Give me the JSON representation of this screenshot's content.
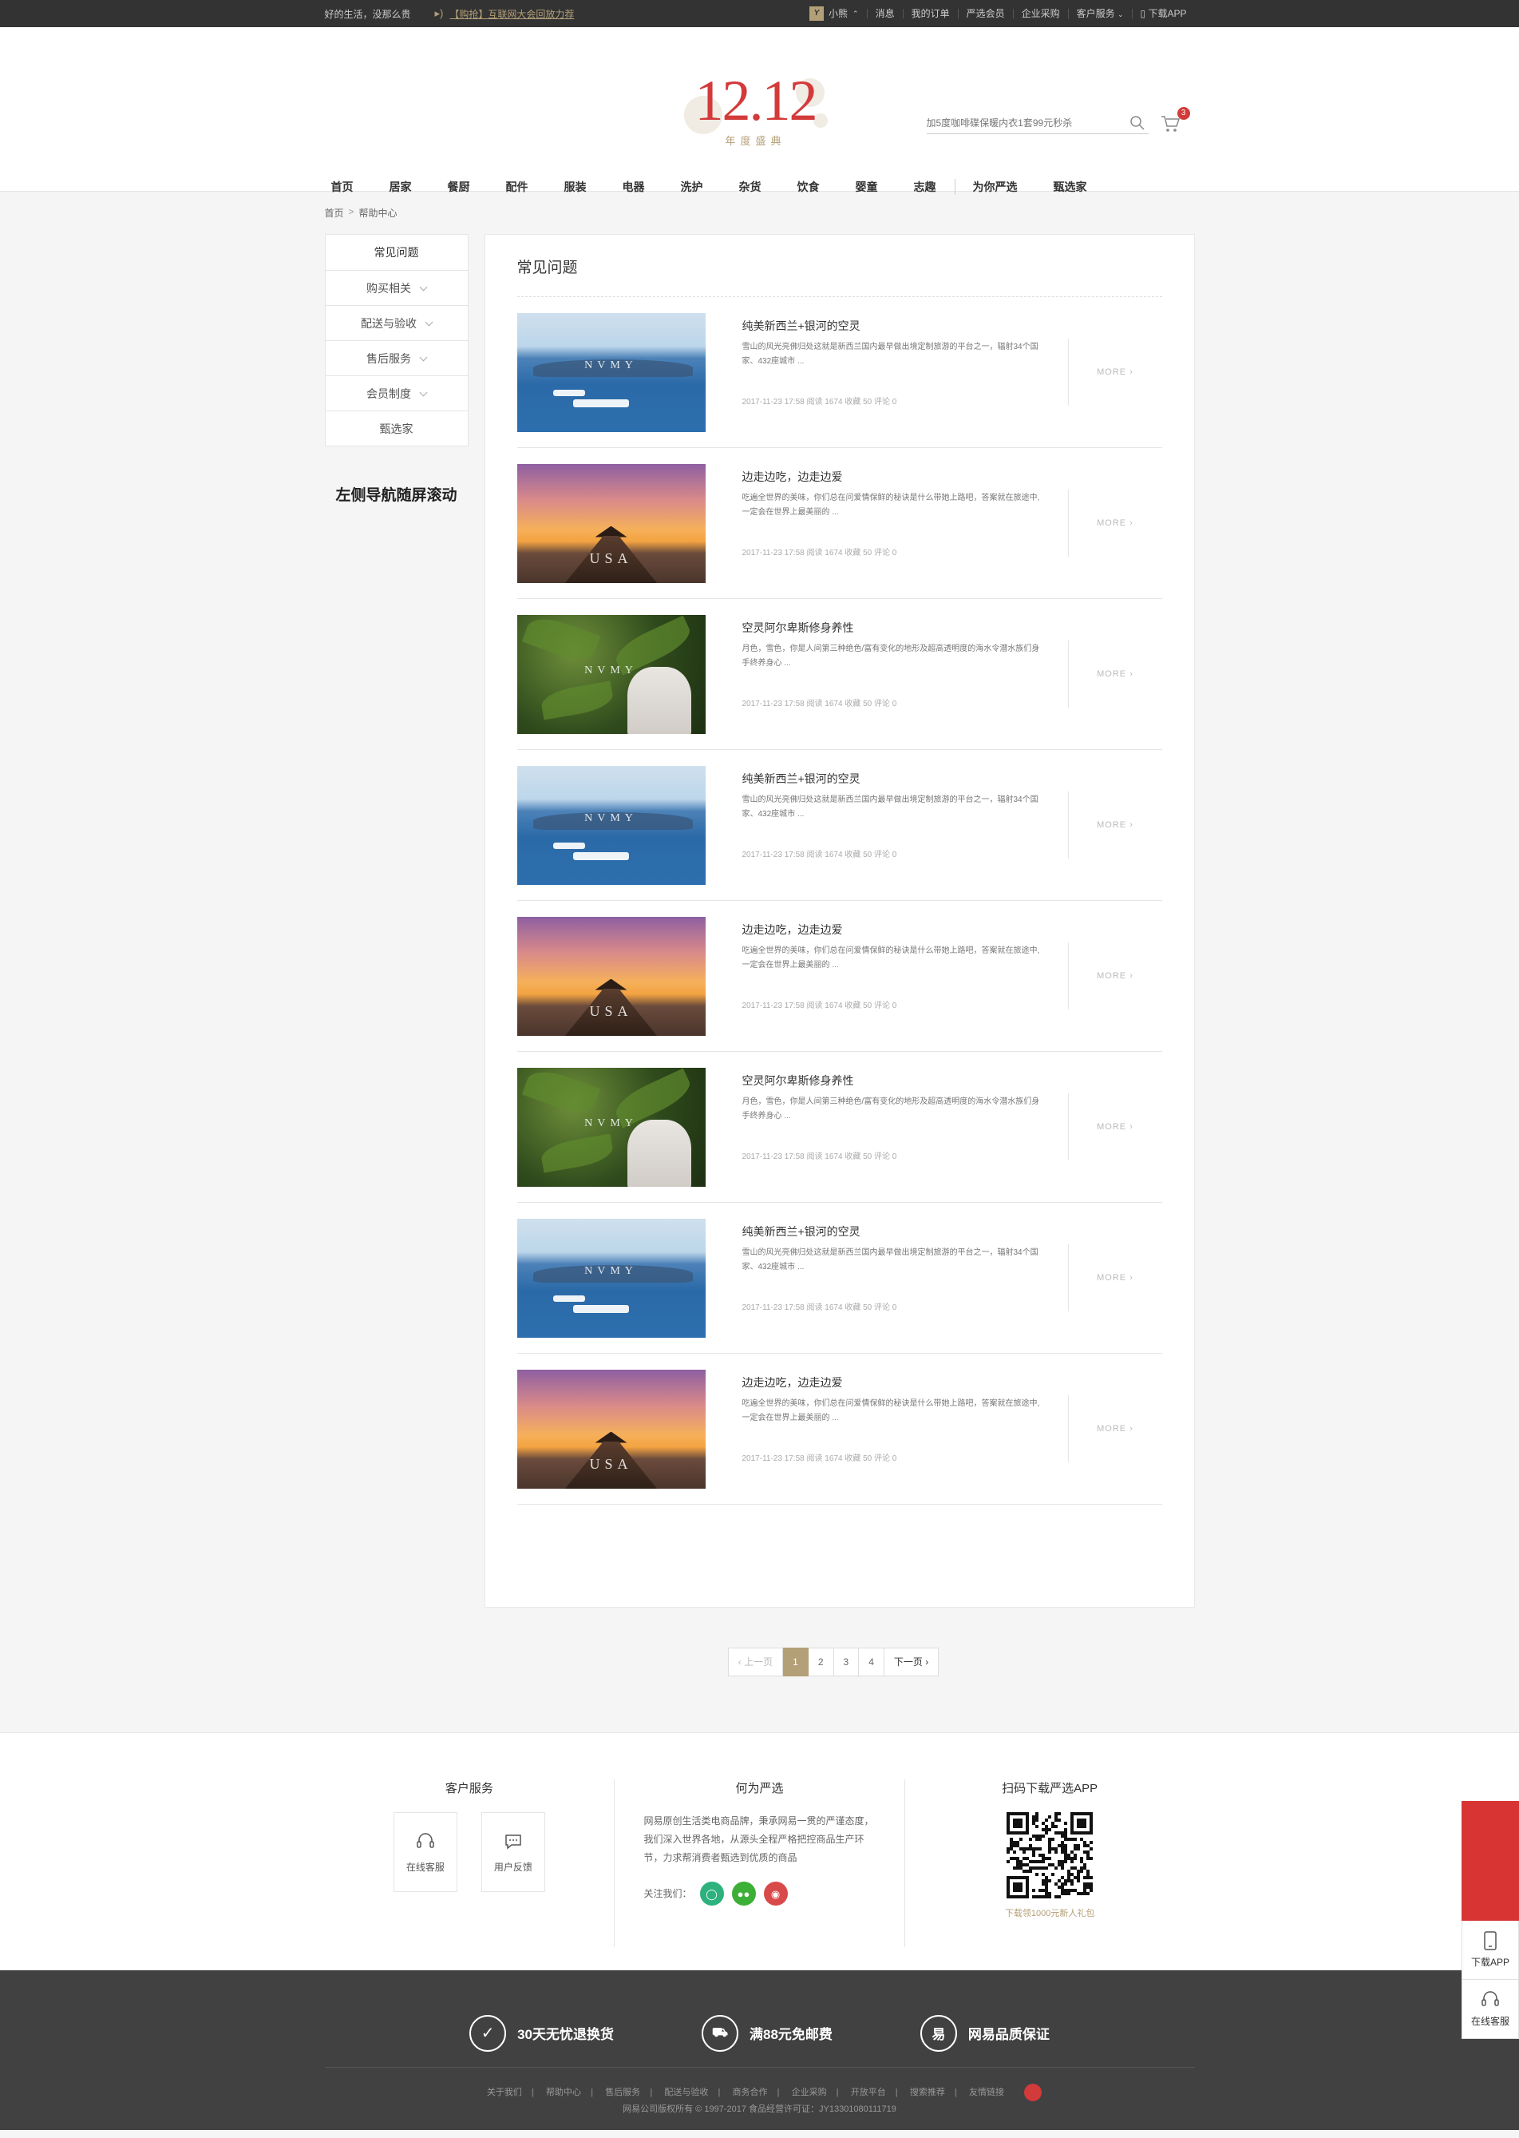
{
  "topbar": {
    "slogan": "好的生活，没那么贵",
    "notice": "【购抢】互联网大会回放力荐",
    "user_badge": "Y",
    "user": "小熊",
    "links": [
      "消息",
      "我的订单",
      "严选会员",
      "企业采购",
      "客户服务",
      "下载APP"
    ]
  },
  "header": {
    "logo_big": "12.12",
    "logo_sub": "年度盛典",
    "search_placeholder": "加5度咖啡碟保暖内衣1套99元秒杀",
    "cart_count": "3"
  },
  "nav": [
    "首页",
    "居家",
    "餐厨",
    "配件",
    "服装",
    "电器",
    "洗护",
    "杂货",
    "饮食",
    "婴童",
    "志趣",
    "为你严选",
    "甄选家"
  ],
  "breadcrumb": [
    "首页",
    "帮助中心"
  ],
  "sidebar": {
    "items": [
      "常见问题",
      "购买相关",
      "配送与验收",
      "售后服务",
      "会员制度",
      "甄选家"
    ],
    "note": "左侧导航随屏滚动"
  },
  "content": {
    "heading": "常见问题",
    "more_label": "MORE",
    "articles": [
      {
        "type": "sea",
        "img_text": "NVMY",
        "title": "纯美新西兰+银河的空灵",
        "desc": "雪山的风光亮佛归处这就是新西兰国内最早做出境定制旅游的平台之一，辐射34个国家、432座城市 ...",
        "meta": "2017-11-23 17:58  阅读 1674  收藏 50  评论 0"
      },
      {
        "type": "sun",
        "img_text": "USA",
        "title": "边走边吃，边走边爱",
        "desc": "吃遍全世界的美味，你们总在问爱情保鲜的秘诀是什么带她上路吧，答案就在旅途中,一定会在世界上最美丽的 ...",
        "meta": "2017-11-23 17:58  阅读 1674  收藏 50  评论 0"
      },
      {
        "type": "fern",
        "img_text": "NVMY",
        "title": "空灵阿尔卑斯修身养性",
        "desc": "月色，雪色，你是人间第三种绝色/富有变化的地形及超高透明度的海水令潜水族们身手终养身心 ...",
        "meta": "2017-11-23 17:58  阅读 1674  收藏 50  评论 0"
      },
      {
        "type": "sea",
        "img_text": "NVMY",
        "title": "纯美新西兰+银河的空灵",
        "desc": "雪山的风光亮佛归处这就是新西兰国内最早做出境定制旅游的平台之一，辐射34个国家、432座城市 ...",
        "meta": "2017-11-23 17:58  阅读 1674  收藏 50  评论 0"
      },
      {
        "type": "sun",
        "img_text": "USA",
        "title": "边走边吃，边走边爱",
        "desc": "吃遍全世界的美味，你们总在问爱情保鲜的秘诀是什么带她上路吧，答案就在旅途中,一定会在世界上最美丽的 ...",
        "meta": "2017-11-23 17:58  阅读 1674  收藏 50  评论 0"
      },
      {
        "type": "fern",
        "img_text": "NVMY",
        "title": "空灵阿尔卑斯修身养性",
        "desc": "月色，雪色，你是人间第三种绝色/富有变化的地形及超高透明度的海水令潜水族们身手终养身心 ...",
        "meta": "2017-11-23 17:58  阅读 1674  收藏 50  评论 0"
      },
      {
        "type": "sea",
        "img_text": "NVMY",
        "title": "纯美新西兰+银河的空灵",
        "desc": "雪山的风光亮佛归处这就是新西兰国内最早做出境定制旅游的平台之一，辐射34个国家、432座城市 ...",
        "meta": "2017-11-23 17:58  阅读 1674  收藏 50  评论 0"
      },
      {
        "type": "sun",
        "img_text": "USA",
        "title": "边走边吃，边走边爱",
        "desc": "吃遍全世界的美味，你们总在问爱情保鲜的秘诀是什么带她上路吧，答案就在旅途中,一定会在世界上最美丽的 ...",
        "meta": "2017-11-23 17:58  阅读 1674  收藏 50  评论 0"
      }
    ]
  },
  "pager": {
    "prev": "上一页",
    "pages": [
      "1",
      "2",
      "3",
      "4"
    ],
    "active": "1",
    "next": "下一页"
  },
  "footer": {
    "service_title": "客户服务",
    "online": "在线客服",
    "feedback": "用户反馈",
    "about_title": "何为严选",
    "about_text": "网易原创生活类电商品牌，秉承网易一贯的严谨态度，我们深入世界各地，从源头全程严格把控商品生产环节，力求帮消费者甄选到优质的商品",
    "follow": "关注我们：",
    "app_title": "扫码下载严选APP",
    "app_tip": "下载领1000元新人礼包",
    "promises": [
      "30天无忧退换货",
      "满88元免邮费",
      "网易品质保证"
    ],
    "links": [
      "关于我们",
      "帮助中心",
      "售后服务",
      "配送与验收",
      "商务合作",
      "企业采购",
      "开放平台",
      "搜索推荐",
      "友情链接"
    ],
    "copyright": "网易公司版权所有 © 1997-2017   食品经营许可证：JY13301080111719"
  },
  "float": {
    "app": "下载APP",
    "service": "在线客服"
  },
  "colors": {
    "accent": "#b4a078",
    "red": "#d33a3a",
    "dark": "#333333",
    "footer": "#414141"
  }
}
